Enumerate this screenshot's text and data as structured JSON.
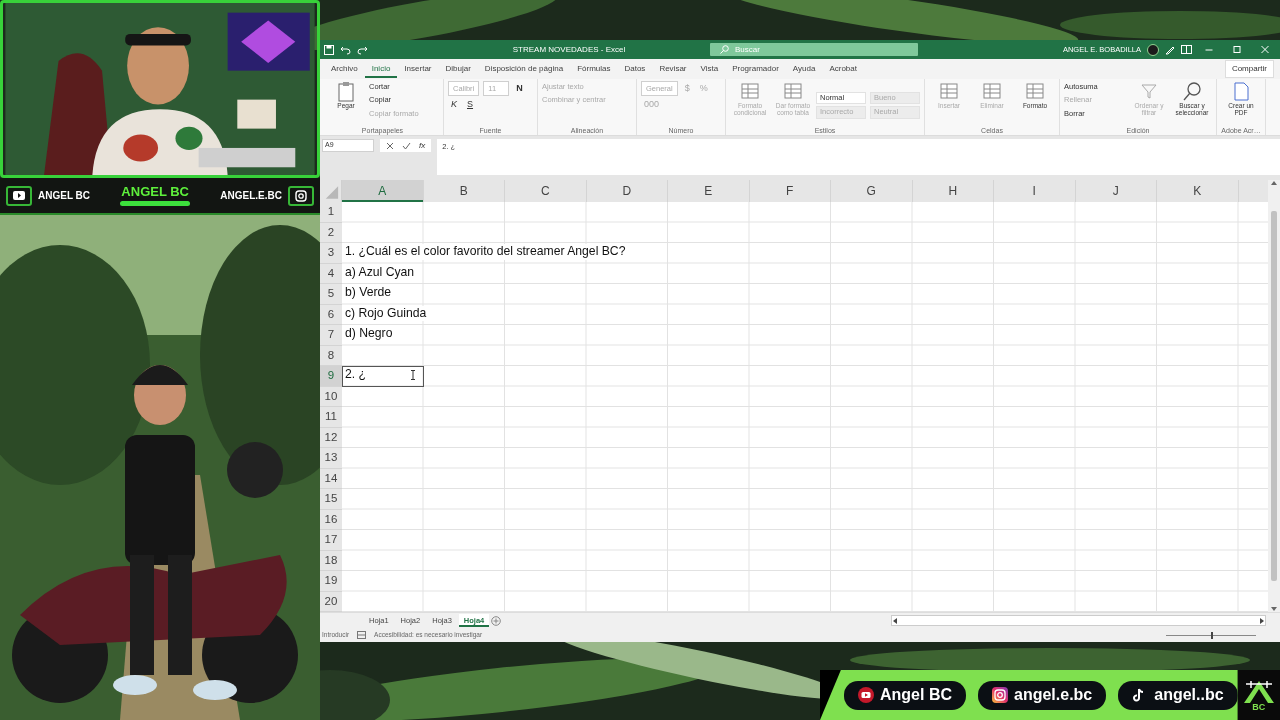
{
  "cam_overlay": {
    "title": "ANGEL BC",
    "youtube": "ANGEL BC",
    "instagram": "ANGEL.E.BC"
  },
  "excel": {
    "title": "STREAM NOVEDADES  -  Excel",
    "search": {
      "placeholder": "Buscar"
    },
    "user": "ANGEL E. BOBADILLA",
    "tabs": [
      {
        "label": "Archivo",
        "selected": false
      },
      {
        "label": "Inicio",
        "selected": true
      },
      {
        "label": "Insertar",
        "selected": false
      },
      {
        "label": "Dibujar",
        "selected": false
      },
      {
        "label": "Disposición de página",
        "selected": false
      },
      {
        "label": "Fórmulas",
        "selected": false
      },
      {
        "label": "Datos",
        "selected": false
      },
      {
        "label": "Revisar",
        "selected": false
      },
      {
        "label": "Vista",
        "selected": false
      },
      {
        "label": "Programador",
        "selected": false
      },
      {
        "label": "Ayuda",
        "selected": false
      },
      {
        "label": "Acrobat",
        "selected": false
      }
    ],
    "share": "Compartir",
    "ribbon": [
      {
        "label": "Portapapeles",
        "items": [
          {
            "kind": "big",
            "label": "Pegar",
            "disabled": false
          },
          {
            "kind": "small",
            "label": "Cortar",
            "disabled": false
          },
          {
            "kind": "small",
            "label": "Copiar",
            "disabled": false
          },
          {
            "kind": "small",
            "label": "Copiar formato",
            "disabled": true
          }
        ]
      },
      {
        "label": "Fuente",
        "items": [
          {
            "kind": "field",
            "label": "Calibri",
            "disabled": true
          },
          {
            "kind": "field",
            "label": "11",
            "disabled": true
          },
          {
            "kind": "bold",
            "label": "N",
            "disabled": false
          },
          {
            "kind": "italic",
            "label": "K",
            "disabled": false
          },
          {
            "kind": "underline",
            "label": "S",
            "disabled": false
          }
        ]
      },
      {
        "label": "Alineación",
        "items": [
          {
            "kind": "small",
            "label": "Ajustar texto",
            "disabled": true
          },
          {
            "kind": "small",
            "label": "Combinar y centrar",
            "disabled": true
          }
        ]
      },
      {
        "label": "Número",
        "items": [
          {
            "kind": "field",
            "label": "General",
            "disabled": true
          },
          {
            "kind": "text",
            "label": "$",
            "disabled": true
          },
          {
            "kind": "text",
            "label": "%",
            "disabled": true
          },
          {
            "kind": "text",
            "label": "000",
            "disabled": true
          }
        ]
      },
      {
        "label": "Estilos",
        "items": [
          {
            "kind": "big",
            "label": "Formato condicional",
            "disabled": true
          },
          {
            "kind": "big",
            "label": "Dar formato como tabla",
            "disabled": true
          },
          {
            "kind": "style",
            "label": "Normal",
            "disabled": false
          },
          {
            "kind": "style",
            "label": "Bueno",
            "disabled": true
          },
          {
            "kind": "style",
            "label": "Incorrecto",
            "disabled": true
          },
          {
            "kind": "style",
            "label": "Neutral",
            "disabled": true
          }
        ]
      },
      {
        "label": "Celdas",
        "items": [
          {
            "kind": "big",
            "label": "Insertar",
            "disabled": true
          },
          {
            "kind": "big",
            "label": "Eliminar",
            "disabled": true
          },
          {
            "kind": "big",
            "label": "Formato",
            "disabled": false
          }
        ]
      },
      {
        "label": "Edición",
        "items": [
          {
            "kind": "small",
            "label": "Autosuma",
            "disabled": false
          },
          {
            "kind": "small",
            "label": "Rellenar",
            "disabled": true
          },
          {
            "kind": "small",
            "label": "Borrar",
            "disabled": false
          },
          {
            "kind": "big",
            "label": "Ordenar y filtrar",
            "disabled": true
          },
          {
            "kind": "big",
            "label": "Buscar y seleccionar",
            "disabled": false
          }
        ]
      },
      {
        "label": "Adobe Acr…",
        "items": [
          {
            "kind": "big",
            "label": "Crear un PDF",
            "disabled": false
          }
        ]
      }
    ],
    "name_box": "A9",
    "fx": "fx",
    "formula": "2. ¿",
    "grid": {
      "columns": [
        {
          "label": "A",
          "selected": true
        },
        {
          "label": "B",
          "selected": false
        },
        {
          "label": "C",
          "selected": false
        },
        {
          "label": "D",
          "selected": false
        },
        {
          "label": "E",
          "selected": false
        },
        {
          "label": "F",
          "selected": false
        },
        {
          "label": "G",
          "selected": false
        },
        {
          "label": "H",
          "selected": false
        },
        {
          "label": "I",
          "selected": false
        },
        {
          "label": "J",
          "selected": false
        },
        {
          "label": "K",
          "selected": false
        }
      ],
      "rows": [
        {
          "number": "1",
          "selected": false
        },
        {
          "number": "2",
          "selected": false
        },
        {
          "number": "3",
          "text": "1. ¿Cuál es el color favorito del streamer Angel BC?",
          "selected": false
        },
        {
          "number": "4",
          "text": "a) Azul Cyan",
          "selected": false
        },
        {
          "number": "5",
          "text": "b) Verde",
          "selected": false
        },
        {
          "number": "6",
          "text": "c) Rojo Guinda",
          "selected": false
        },
        {
          "number": "7",
          "text": "d) Negro",
          "selected": false
        },
        {
          "number": "8",
          "selected": false
        },
        {
          "number": "9",
          "text": "2. ¿",
          "selected": true
        },
        {
          "number": "10",
          "selected": false
        },
        {
          "number": "11",
          "selected": false
        },
        {
          "number": "12",
          "selected": false
        },
        {
          "number": "13",
          "selected": false
        },
        {
          "number": "14",
          "selected": false
        },
        {
          "number": "15",
          "selected": false
        },
        {
          "number": "16",
          "selected": false
        },
        {
          "number": "17",
          "selected": false
        },
        {
          "number": "18",
          "selected": false
        },
        {
          "number": "19",
          "selected": false
        },
        {
          "number": "20",
          "selected": false
        }
      ]
    },
    "sheets": [
      {
        "label": "Hoja1",
        "selected": false
      },
      {
        "label": "Hoja2",
        "selected": false
      },
      {
        "label": "Hoja3",
        "selected": false
      },
      {
        "label": "Hoja4",
        "selected": true
      }
    ],
    "status": {
      "mode": "Introducir",
      "accessibility": "Accesibilidad: es necesario investigar"
    },
    "zoom_slider": {
      "level": 0.5
    }
  },
  "socials": [
    {
      "kind": "youtube",
      "label": "Angel BC"
    },
    {
      "kind": "instagram",
      "label": "angel.e.bc"
    },
    {
      "kind": "tiktok",
      "label": "angel..bc"
    }
  ],
  "logo": "BC"
}
